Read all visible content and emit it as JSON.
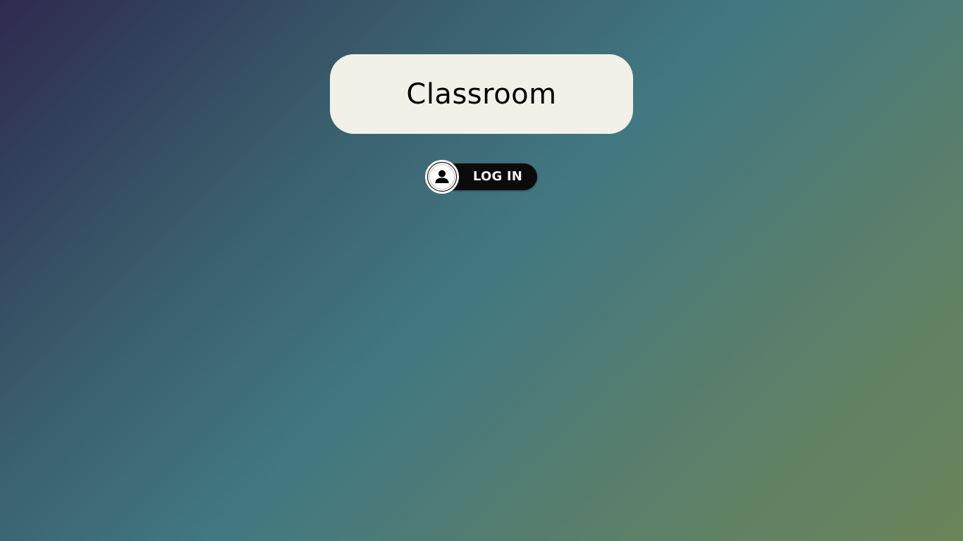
{
  "app": {
    "title": "Classroom"
  },
  "login": {
    "label": "LOG IN",
    "icon": "user-icon"
  },
  "colors": {
    "card_background": "#f2f1e8",
    "button_background": "#0b0b0b",
    "button_text": "#f2f2f2",
    "gradient_start": "#2e2a4f",
    "gradient_mid": "#417882",
    "gradient_end": "#6b855a"
  }
}
